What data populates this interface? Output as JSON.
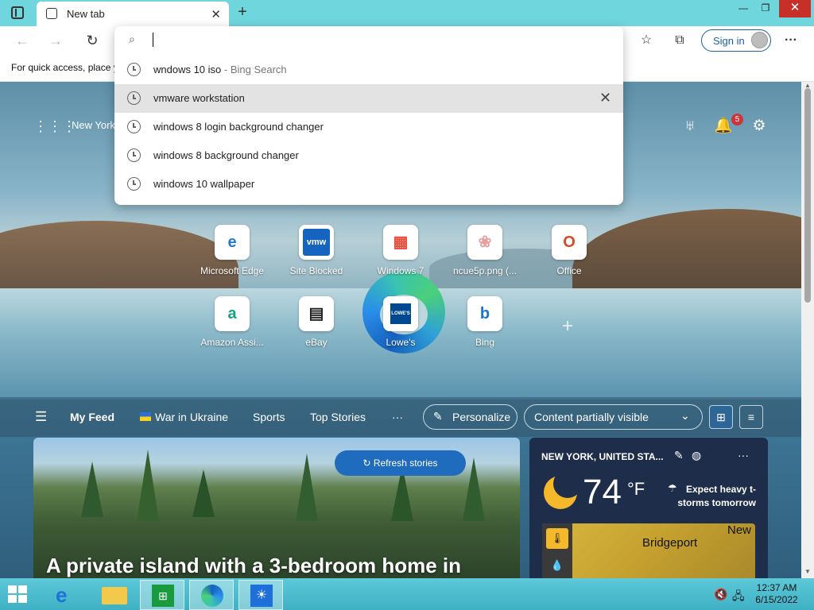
{
  "tab": {
    "title": "New tab"
  },
  "favbar": {
    "text": "For quick access, place y"
  },
  "toolbar": {
    "signin_label": "Sign in"
  },
  "omnibox": {
    "placeholder": "",
    "suggestions": [
      {
        "text": "wndows 10 iso",
        "sub": " - Bing Search"
      },
      {
        "text": "vmware workstation",
        "sub": ""
      },
      {
        "text": "windows 8 login background changer",
        "sub": ""
      },
      {
        "text": "windows 8 background changer",
        "sub": ""
      },
      {
        "text": "windows 10 wallpaper",
        "sub": ""
      }
    ]
  },
  "ntp": {
    "location": "New York",
    "notification_count": "5",
    "tiles": [
      {
        "label": "Microsoft Edge",
        "glyph": "e",
        "color": "#1f7ad6"
      },
      {
        "label": "Site Blocked",
        "glyph": "vmw",
        "color": "#1565c0"
      },
      {
        "label": "Windows 7",
        "glyph": "▦",
        "color": "#e74c3c"
      },
      {
        "label": "ncue5p.png (...",
        "glyph": "❀",
        "color": "#e8a0a0"
      },
      {
        "label": "Office",
        "glyph": "O",
        "color": "#d64b24"
      },
      {
        "label": "Amazon Assi...",
        "glyph": "a",
        "color": "#11a683"
      },
      {
        "label": "eBay",
        "glyph": "▤",
        "color": "#222222"
      },
      {
        "label": "Lowe's",
        "glyph": "LOWE'S",
        "color": "#004990"
      },
      {
        "label": "Bing",
        "glyph": "b",
        "color": "#1b74c6"
      }
    ]
  },
  "feed": {
    "title": "My Feed",
    "items": [
      "War in Ukraine",
      "Sports",
      "Top Stories",
      "···"
    ],
    "personalize": "Personalize",
    "content_filter": "Content partially visible",
    "refresh": "Refresh stories",
    "headline": "A private island with a 3-bedroom home in"
  },
  "weather": {
    "location": "NEW YORK, UNITED STA...",
    "temp": "74",
    "unit": "°F",
    "forecast_line1": "Expect heavy t-",
    "forecast_line2": "storms tomorrow",
    "map_city": "Bridgeport",
    "map_label2": "New"
  },
  "clock": {
    "time": "12:37 AM",
    "date": "6/15/2022"
  },
  "colors": {
    "accent": "#1f6cbf",
    "titlebar": "#6fd6de",
    "taskbar": "#4dbfd0"
  }
}
